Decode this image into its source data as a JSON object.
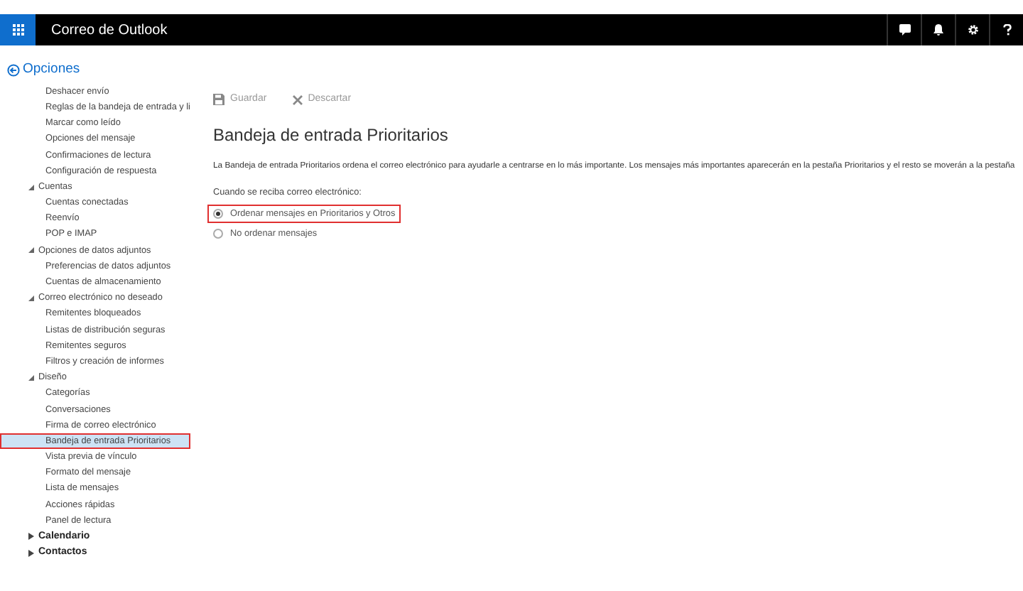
{
  "header": {
    "title": "Correo de Outlook"
  },
  "back_link": {
    "label": "Opciones"
  },
  "sidebar": {
    "leading_items": [
      {
        "label": "Deshacer envío",
        "selected": false
      },
      {
        "label": "Reglas de la bandeja de entrada y li",
        "selected": false
      },
      {
        "label": "Marcar como leído",
        "selected": false
      },
      {
        "label": "Opciones del mensaje",
        "selected": false
      },
      {
        "label": "Confirmaciones de lectura",
        "selected": false
      },
      {
        "label": "Configuración de respuesta",
        "selected": false
      }
    ],
    "groups": [
      {
        "label": "Cuentas",
        "expanded": true,
        "bold": false,
        "children": [
          {
            "label": "Cuentas conectadas",
            "selected": false
          },
          {
            "label": "Reenvío",
            "selected": false
          },
          {
            "label": "POP e IMAP",
            "selected": false
          }
        ]
      },
      {
        "label": "Opciones de datos adjuntos",
        "expanded": true,
        "bold": false,
        "children": [
          {
            "label": "Preferencias de datos adjuntos",
            "selected": false
          },
          {
            "label": "Cuentas de almacenamiento",
            "selected": false
          }
        ]
      },
      {
        "label": "Correo electrónico no deseado",
        "expanded": true,
        "bold": false,
        "children": [
          {
            "label": "Remitentes bloqueados",
            "selected": false
          },
          {
            "label": "Listas de distribución seguras",
            "selected": false
          },
          {
            "label": "Remitentes seguros",
            "selected": false
          },
          {
            "label": "Filtros y creación de informes",
            "selected": false
          }
        ]
      },
      {
        "label": "Diseño",
        "expanded": true,
        "bold": false,
        "children": [
          {
            "label": "Categorías",
            "selected": false
          },
          {
            "label": "Conversaciones",
            "selected": false
          },
          {
            "label": "Firma de correo electrónico",
            "selected": false
          },
          {
            "label": "Bandeja de entrada Prioritarios",
            "selected": true
          },
          {
            "label": "Vista previa de vínculo",
            "selected": false
          },
          {
            "label": "Formato del mensaje",
            "selected": false
          },
          {
            "label": "Lista de mensajes",
            "selected": false
          },
          {
            "label": "Acciones rápidas",
            "selected": false
          },
          {
            "label": "Panel de lectura",
            "selected": false
          }
        ]
      },
      {
        "label": "Calendario",
        "expanded": false,
        "bold": true
      },
      {
        "label": "Contactos",
        "expanded": false,
        "bold": true
      }
    ]
  },
  "toolbar": [
    {
      "label": "Guardar",
      "kind": "save",
      "disabled": true
    },
    {
      "label": "Descartar",
      "kind": "discard",
      "disabled": true
    }
  ],
  "page": {
    "title": "Bandeja de entrada Prioritarios",
    "description": "La Bandeja de entrada Prioritarios ordena el correo electrónico para ayudarle a centrarse en lo más importante. Los mensajes más importantes aparecerán en la pestaña Prioritarios y el resto se moverán a la pestaña",
    "prompt": "Cuando se reciba correo electrónico:",
    "options": [
      {
        "label": "Ordenar mensajes en Prioritarios y Otros",
        "selected": true
      },
      {
        "label": "No ordenar mensajes",
        "selected": false
      }
    ]
  }
}
